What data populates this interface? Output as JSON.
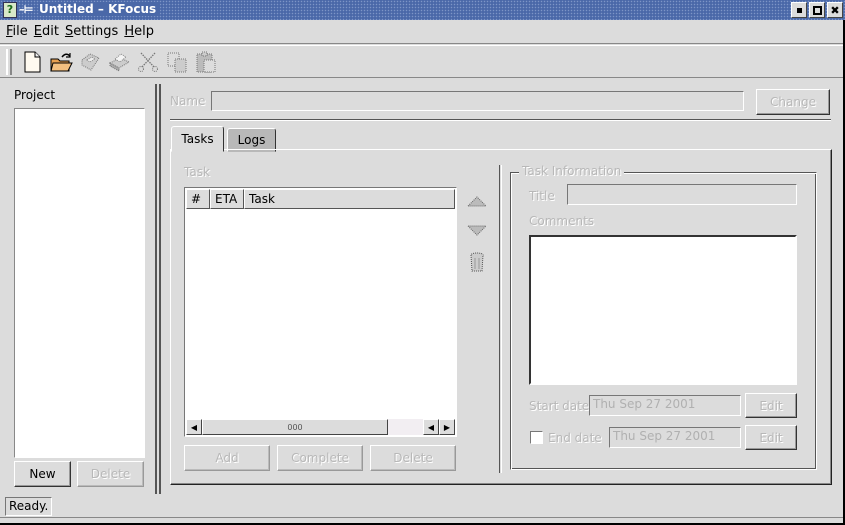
{
  "window": {
    "title": "Untitled  –  KFocus",
    "buttons": [
      "minimize",
      "maximize",
      "close"
    ]
  },
  "menubar": {
    "items": [
      {
        "label": "File",
        "mnemonic": "F",
        "rest": "ile"
      },
      {
        "label": "Edit",
        "mnemonic": "E",
        "rest": "dit"
      },
      {
        "label": "Settings",
        "mnemonic": "S",
        "rest": "ettings"
      },
      {
        "label": "Help",
        "mnemonic": "H",
        "rest": "elp"
      }
    ]
  },
  "toolbar": {
    "items": [
      {
        "icon": "new-file-icon",
        "enabled": true
      },
      {
        "icon": "open-folder-icon",
        "enabled": true
      },
      {
        "icon": "save-icon",
        "enabled": false
      },
      {
        "icon": "print-icon",
        "enabled": false
      },
      {
        "icon": "cut-icon",
        "enabled": false
      },
      {
        "icon": "copy-icon",
        "enabled": false
      },
      {
        "icon": "paste-icon",
        "enabled": false
      }
    ]
  },
  "project_panel": {
    "label": "Project",
    "items": [],
    "new_label": "New",
    "delete_label": "Delete"
  },
  "name_row": {
    "label": "Name",
    "value": "",
    "change_label": "Change"
  },
  "tabs": [
    {
      "label": "Tasks",
      "active": true
    },
    {
      "label": "Logs",
      "active": false
    }
  ],
  "tasks": {
    "section_label": "Task",
    "columns": [
      "#",
      "ETA",
      "Task"
    ],
    "rows": [],
    "scroll_thumb_label": "000",
    "add_label": "Add",
    "complete_label": "Complete",
    "delete_label": "Delete",
    "side_icons": [
      "move-up-icon",
      "move-down-icon",
      "trash-icon"
    ]
  },
  "task_info": {
    "group_title": "Task Information",
    "title_label": "Title",
    "title_value": "",
    "comments_label": "Comments",
    "comments_value": "",
    "start_date_label": "Start date",
    "start_date_value": "Thu Sep 27 2001",
    "end_date_label": "End date",
    "end_date_value": "Thu Sep 27 2001",
    "end_date_checked": false,
    "edit_label": "Edit"
  },
  "statusbar": {
    "text": "Ready."
  },
  "colors": {
    "titlebar": "#4a68a8",
    "background": "#dcdcdc",
    "disabled_text": "#b8b8b8"
  }
}
